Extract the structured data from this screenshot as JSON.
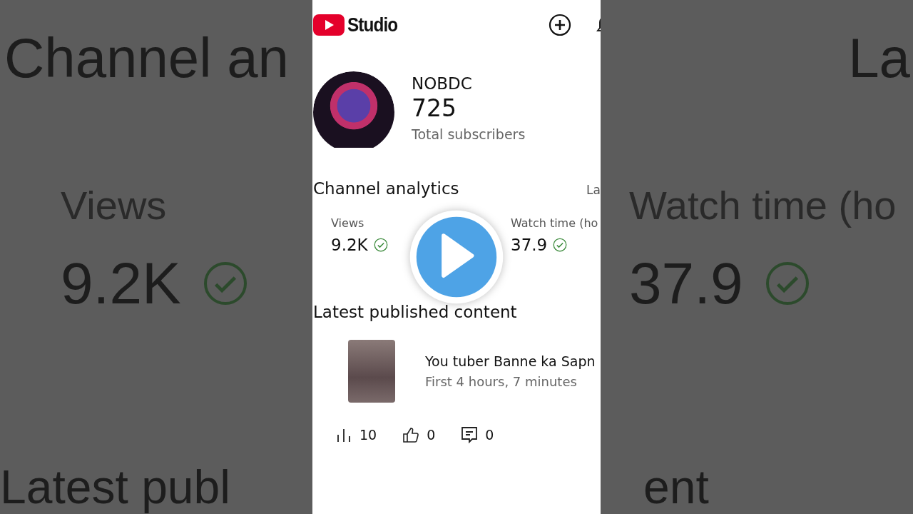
{
  "backdrop": {
    "left": [
      {
        "kind": "heading",
        "text": "Channel an"
      },
      {
        "kind": "label",
        "text": "Views"
      },
      {
        "kind": "value",
        "text": "9.2K",
        "verified": true
      },
      {
        "kind": "footer",
        "text": "Latest publ"
      }
    ],
    "right": [
      {
        "kind": "heading",
        "text": "La"
      },
      {
        "kind": "label",
        "text": "Watch time (ho"
      },
      {
        "kind": "value",
        "text": "37.9",
        "verified": true
      },
      {
        "kind": "footer",
        "text": "ent"
      }
    ]
  },
  "header": {
    "title": "Studio"
  },
  "channel": {
    "name": "NOBDC",
    "subscribers": "725",
    "subscribers_label": "Total subscribers"
  },
  "analytics": {
    "title": "Channel analytics",
    "period": "La",
    "metrics": [
      {
        "label": "Views",
        "value": "9.2K",
        "verified": true
      },
      {
        "label": "Watch time (ho",
        "value": "37.9",
        "verified": true
      }
    ]
  },
  "latest": {
    "title": "Latest published content",
    "video": {
      "title": "You tuber Banne ka Sapn",
      "subtitle": "First 4 hours, 7 minutes",
      "stats": [
        {
          "kind": "views",
          "value": "10"
        },
        {
          "kind": "likes",
          "value": "0"
        },
        {
          "kind": "comments",
          "value": "0"
        }
      ]
    }
  },
  "overlay": {
    "play_button": true
  }
}
